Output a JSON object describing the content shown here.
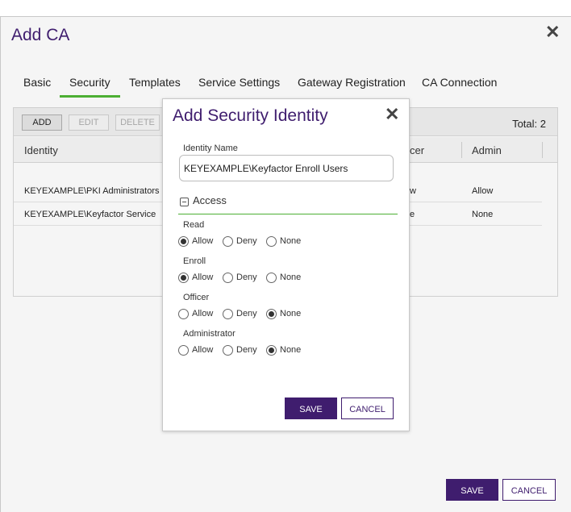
{
  "outer_dialog": {
    "title": "Add CA",
    "close_glyph": "✕",
    "tabs": [
      {
        "label": "Basic",
        "active": false
      },
      {
        "label": "Security",
        "active": true
      },
      {
        "label": "Templates",
        "active": false
      },
      {
        "label": "Service Settings",
        "active": false
      },
      {
        "label": "Gateway Registration",
        "active": false
      },
      {
        "label": "CA Connection",
        "active": false
      }
    ],
    "grid": {
      "toolbar": {
        "add_label": "ADD",
        "edit_label": "EDIT",
        "delete_label": "DELETE",
        "total_label": "Total: 2"
      },
      "columns": [
        "Identity",
        "cer",
        "Admin"
      ],
      "rows": [
        {
          "identity": "KEYEXAMPLE\\PKI Administrators",
          "officer": "w",
          "admin": "Allow"
        },
        {
          "identity": "KEYEXAMPLE\\Keyfactor Service",
          "officer": "e",
          "admin": "None"
        }
      ]
    },
    "save_label": "SAVE",
    "cancel_label": "CANCEL"
  },
  "modal": {
    "title": "Add Security Identity",
    "close_glyph": "✕",
    "identity_name_label": "Identity Name",
    "identity_name_value": "KEYEXAMPLE\\Keyfactor Enroll Users",
    "access_section_title": "Access",
    "options": [
      "Allow",
      "Deny",
      "None"
    ],
    "permissions": [
      {
        "label": "Read",
        "selected": "Allow"
      },
      {
        "label": "Enroll",
        "selected": "Allow"
      },
      {
        "label": "Officer",
        "selected": "None"
      },
      {
        "label": "Administrator",
        "selected": "None"
      }
    ],
    "save_label": "SAVE",
    "cancel_label": "CANCEL"
  },
  "colors": {
    "brand_purple": "#3f1d6e",
    "tab_active_underline": "#4caf33"
  }
}
